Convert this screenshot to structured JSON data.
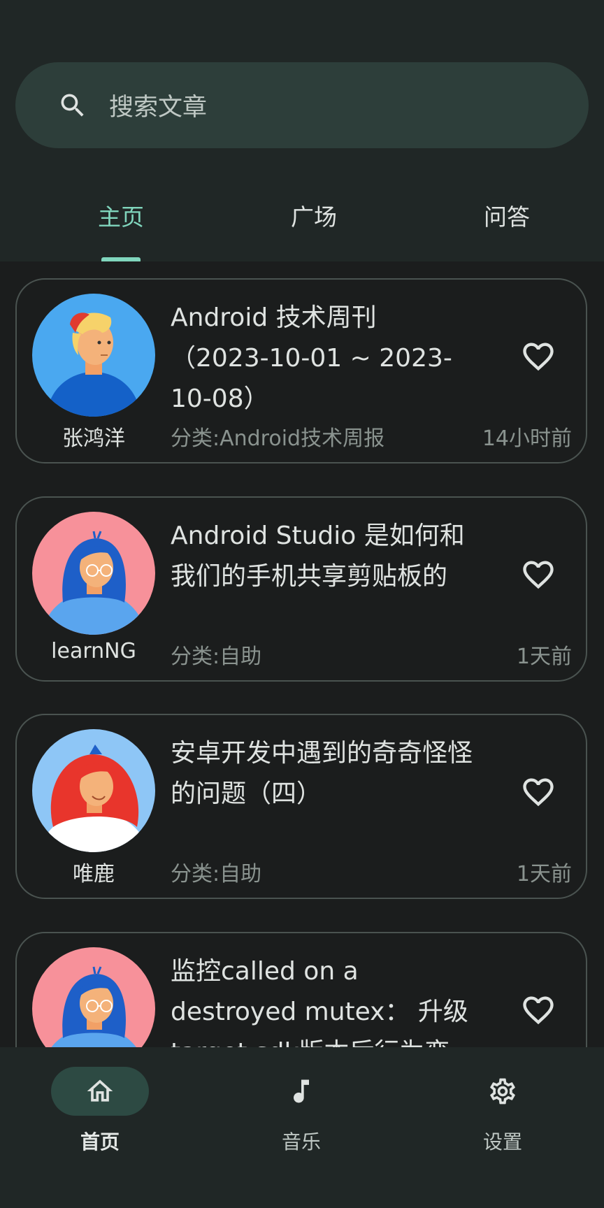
{
  "search": {
    "placeholder": "搜索文章"
  },
  "tabs": [
    {
      "label": "主页",
      "active": true
    },
    {
      "label": "广场",
      "active": false
    },
    {
      "label": "问答",
      "active": false
    }
  ],
  "articles": [
    {
      "author": "张鸿洋",
      "title": "Android 技术周刊 （2023-10-01 ~ 2023-10-08）",
      "category": "分类:Android技术周报",
      "time": "14小时前",
      "avatar": "man-avatar-blue"
    },
    {
      "author": "learnNG",
      "title": "Android Studio 是如何和我们的手机共享剪贴板的",
      "category": "分类:自助",
      "time": "1天前",
      "avatar": "woman-avatar-pink"
    },
    {
      "author": "唯鹿",
      "title": "安卓开发中遇到的奇奇怪怪的问题（四）",
      "category": "分类:自助",
      "time": "1天前",
      "avatar": "woman-avatar-red-hair"
    },
    {
      "author": "",
      "title": "监控called on a destroyed mutex： 升级target sdk版本后行为变",
      "category": "",
      "time": "",
      "avatar": "woman-avatar-pink"
    }
  ],
  "bottom_nav": [
    {
      "label": "首页",
      "icon": "home-icon",
      "active": true
    },
    {
      "label": "音乐",
      "icon": "music-note-icon",
      "active": false
    },
    {
      "label": "设置",
      "icon": "gear-icon",
      "active": false
    }
  ],
  "colors": {
    "accent": "#80d6bd",
    "background": "#1b1d1d",
    "surface": "#202726",
    "search_bg": "#2d3e3a"
  }
}
